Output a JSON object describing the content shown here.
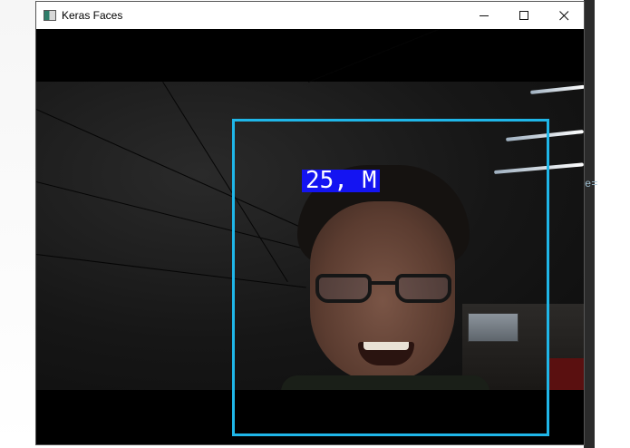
{
  "window": {
    "title": "Keras Faces",
    "icon": "app-window-icon",
    "controls": {
      "minimize_icon": "minimize-icon",
      "maximize_icon": "maximize-icon",
      "close_icon": "close-icon"
    }
  },
  "camera": {
    "prediction_label": "25, M",
    "box_color": "#1fb6e8",
    "label_bg_color": "#1414f2"
  },
  "background_fragment": "e="
}
